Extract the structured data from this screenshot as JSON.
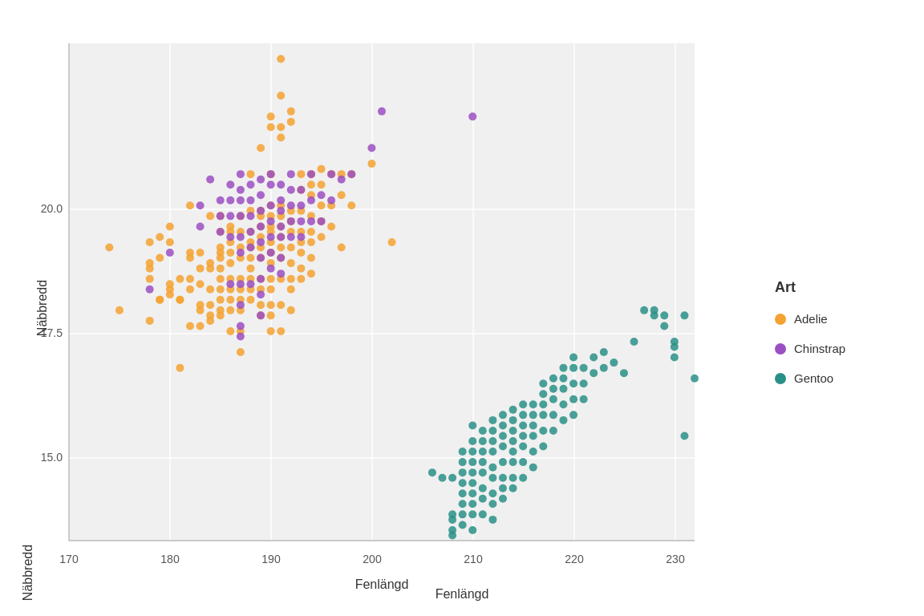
{
  "chart": {
    "title": "",
    "x_label": "Fenlängd",
    "y_label": "Näbbredd",
    "x_min": 170,
    "x_max": 232,
    "y_min": 13.0,
    "y_max": 22.5,
    "x_ticks": [
      170,
      180,
      190,
      200,
      210,
      220,
      230
    ],
    "y_ticks": [
      15.0,
      17.5,
      20.0
    ],
    "background_color": "#f5f5f5",
    "grid_color": "#ffffff"
  },
  "legend": {
    "title": "Art",
    "items": [
      {
        "label": "Adelie",
        "color": "#F4A231",
        "dot_color": "#F4A231"
      },
      {
        "label": "Chinstrap",
        "color": "#9B4FC2",
        "dot_color": "#9B4FC2"
      },
      {
        "label": "Gentoo",
        "color": "#2A9087",
        "dot_color": "#2A9087"
      }
    ]
  },
  "data": {
    "adelie": [
      [
        174,
        18.6
      ],
      [
        175,
        17.4
      ],
      [
        178,
        18.7
      ],
      [
        178,
        18.3
      ],
      [
        178,
        18.0
      ],
      [
        178,
        18.2
      ],
      [
        178,
        17.2
      ],
      [
        179,
        17.6
      ],
      [
        179,
        18.8
      ],
      [
        179,
        17.6
      ],
      [
        179,
        18.4
      ],
      [
        180,
        19.0
      ],
      [
        180,
        18.7
      ],
      [
        180,
        17.9
      ],
      [
        180,
        17.7
      ],
      [
        180,
        17.8
      ],
      [
        181,
        18.0
      ],
      [
        181,
        17.6
      ],
      [
        181,
        17.6
      ],
      [
        181,
        16.3
      ],
      [
        182,
        19.4
      ],
      [
        182,
        18.5
      ],
      [
        182,
        18.4
      ],
      [
        182,
        18.0
      ],
      [
        182,
        17.8
      ],
      [
        182,
        17.1
      ],
      [
        183,
        18.5
      ],
      [
        183,
        18.2
      ],
      [
        183,
        17.9
      ],
      [
        183,
        17.5
      ],
      [
        183,
        17.4
      ],
      [
        183,
        17.1
      ],
      [
        184,
        19.2
      ],
      [
        184,
        18.3
      ],
      [
        184,
        18.2
      ],
      [
        184,
        17.8
      ],
      [
        184,
        17.5
      ],
      [
        184,
        17.3
      ],
      [
        184,
        17.2
      ],
      [
        185,
        19.2
      ],
      [
        185,
        18.9
      ],
      [
        185,
        18.6
      ],
      [
        185,
        18.5
      ],
      [
        185,
        18.4
      ],
      [
        185,
        18.2
      ],
      [
        185,
        18.0
      ],
      [
        185,
        17.8
      ],
      [
        185,
        17.6
      ],
      [
        185,
        17.4
      ],
      [
        185,
        17.3
      ],
      [
        186,
        19.0
      ],
      [
        186,
        18.9
      ],
      [
        186,
        18.7
      ],
      [
        186,
        18.5
      ],
      [
        186,
        18.3
      ],
      [
        186,
        18.0
      ],
      [
        186,
        17.8
      ],
      [
        186,
        17.6
      ],
      [
        186,
        17.4
      ],
      [
        186,
        17.0
      ],
      [
        187,
        19.2
      ],
      [
        187,
        18.9
      ],
      [
        187,
        18.6
      ],
      [
        187,
        18.4
      ],
      [
        187,
        18.0
      ],
      [
        187,
        17.8
      ],
      [
        187,
        17.6
      ],
      [
        187,
        17.4
      ],
      [
        187,
        17.0
      ],
      [
        187,
        16.6
      ],
      [
        188,
        20.0
      ],
      [
        188,
        19.3
      ],
      [
        188,
        18.9
      ],
      [
        188,
        18.7
      ],
      [
        188,
        18.6
      ],
      [
        188,
        18.4
      ],
      [
        188,
        18.2
      ],
      [
        188,
        18.0
      ],
      [
        188,
        17.8
      ],
      [
        188,
        17.6
      ],
      [
        189,
        20.5
      ],
      [
        189,
        19.3
      ],
      [
        189,
        19.2
      ],
      [
        189,
        19.0
      ],
      [
        189,
        18.8
      ],
      [
        189,
        18.6
      ],
      [
        189,
        18.4
      ],
      [
        189,
        18.0
      ],
      [
        189,
        17.8
      ],
      [
        189,
        17.5
      ],
      [
        189,
        17.3
      ],
      [
        190,
        21.1
      ],
      [
        190,
        20.9
      ],
      [
        190,
        20.0
      ],
      [
        190,
        19.4
      ],
      [
        190,
        19.2
      ],
      [
        190,
        19.0
      ],
      [
        190,
        18.9
      ],
      [
        190,
        18.7
      ],
      [
        190,
        18.5
      ],
      [
        190,
        18.3
      ],
      [
        190,
        18.0
      ],
      [
        190,
        17.8
      ],
      [
        190,
        17.5
      ],
      [
        190,
        17.3
      ],
      [
        190,
        17.0
      ],
      [
        191,
        22.2
      ],
      [
        191,
        21.5
      ],
      [
        191,
        20.9
      ],
      [
        191,
        20.7
      ],
      [
        191,
        19.4
      ],
      [
        191,
        19.2
      ],
      [
        191,
        19.0
      ],
      [
        191,
        18.8
      ],
      [
        191,
        18.6
      ],
      [
        191,
        18.4
      ],
      [
        191,
        18.0
      ],
      [
        191,
        17.5
      ],
      [
        191,
        17.0
      ],
      [
        192,
        21.2
      ],
      [
        192,
        21.0
      ],
      [
        192,
        19.3
      ],
      [
        192,
        19.1
      ],
      [
        192,
        18.9
      ],
      [
        192,
        18.6
      ],
      [
        192,
        18.3
      ],
      [
        192,
        18.0
      ],
      [
        192,
        17.8
      ],
      [
        192,
        17.4
      ],
      [
        193,
        20.0
      ],
      [
        193,
        19.7
      ],
      [
        193,
        19.3
      ],
      [
        193,
        18.9
      ],
      [
        193,
        18.7
      ],
      [
        193,
        18.5
      ],
      [
        193,
        18.2
      ],
      [
        193,
        18.0
      ],
      [
        194,
        20.0
      ],
      [
        194,
        19.8
      ],
      [
        194,
        19.6
      ],
      [
        194,
        19.2
      ],
      [
        194,
        18.9
      ],
      [
        194,
        18.7
      ],
      [
        194,
        18.4
      ],
      [
        194,
        18.1
      ],
      [
        195,
        20.1
      ],
      [
        195,
        19.8
      ],
      [
        195,
        19.4
      ],
      [
        195,
        19.1
      ],
      [
        195,
        18.8
      ],
      [
        196,
        20.0
      ],
      [
        196,
        19.4
      ],
      [
        196,
        19.0
      ],
      [
        197,
        20.0
      ],
      [
        197,
        19.6
      ],
      [
        197,
        18.6
      ],
      [
        198,
        20.0
      ],
      [
        198,
        19.4
      ],
      [
        200,
        20.2
      ],
      [
        202,
        18.7
      ]
    ],
    "chinstrap": [
      [
        178,
        17.8
      ],
      [
        180,
        18.5
      ],
      [
        183,
        19.4
      ],
      [
        183,
        19.0
      ],
      [
        184,
        19.9
      ],
      [
        185,
        19.5
      ],
      [
        185,
        19.2
      ],
      [
        185,
        18.9
      ],
      [
        186,
        19.8
      ],
      [
        186,
        19.5
      ],
      [
        186,
        19.2
      ],
      [
        186,
        18.8
      ],
      [
        186,
        17.9
      ],
      [
        187,
        20.0
      ],
      [
        187,
        19.7
      ],
      [
        187,
        19.5
      ],
      [
        187,
        19.2
      ],
      [
        187,
        18.8
      ],
      [
        187,
        18.5
      ],
      [
        187,
        17.9
      ],
      [
        187,
        17.5
      ],
      [
        187,
        17.1
      ],
      [
        187,
        16.9
      ],
      [
        188,
        19.8
      ],
      [
        188,
        19.5
      ],
      [
        188,
        19.2
      ],
      [
        188,
        18.9
      ],
      [
        188,
        18.6
      ],
      [
        188,
        17.9
      ],
      [
        189,
        19.9
      ],
      [
        189,
        19.6
      ],
      [
        189,
        19.3
      ],
      [
        189,
        19.0
      ],
      [
        189,
        18.7
      ],
      [
        189,
        18.4
      ],
      [
        189,
        18.0
      ],
      [
        189,
        17.7
      ],
      [
        189,
        17.3
      ],
      [
        190,
        20.0
      ],
      [
        190,
        19.8
      ],
      [
        190,
        19.4
      ],
      [
        190,
        19.1
      ],
      [
        190,
        18.8
      ],
      [
        190,
        18.5
      ],
      [
        190,
        18.2
      ],
      [
        191,
        19.8
      ],
      [
        191,
        19.5
      ],
      [
        191,
        19.3
      ],
      [
        191,
        19.0
      ],
      [
        191,
        18.8
      ],
      [
        191,
        18.4
      ],
      [
        191,
        18.1
      ],
      [
        192,
        20.0
      ],
      [
        192,
        19.7
      ],
      [
        192,
        19.4
      ],
      [
        192,
        19.1
      ],
      [
        192,
        18.8
      ],
      [
        193,
        19.7
      ],
      [
        193,
        19.4
      ],
      [
        193,
        19.1
      ],
      [
        193,
        18.8
      ],
      [
        194,
        20.0
      ],
      [
        194,
        19.5
      ],
      [
        194,
        19.1
      ],
      [
        195,
        19.6
      ],
      [
        195,
        19.1
      ],
      [
        196,
        20.0
      ],
      [
        196,
        19.5
      ],
      [
        197,
        19.9
      ],
      [
        198,
        20.0
      ],
      [
        200,
        20.5
      ],
      [
        201,
        21.2
      ],
      [
        210,
        21.1
      ]
    ],
    "gentoo": [
      [
        206,
        14.3
      ],
      [
        207,
        14.2
      ],
      [
        208,
        14.2
      ],
      [
        208,
        13.5
      ],
      [
        208,
        13.4
      ],
      [
        208,
        13.2
      ],
      [
        208,
        13.1
      ],
      [
        209,
        14.7
      ],
      [
        209,
        14.5
      ],
      [
        209,
        14.3
      ],
      [
        209,
        14.1
      ],
      [
        209,
        13.9
      ],
      [
        209,
        13.7
      ],
      [
        209,
        13.5
      ],
      [
        209,
        13.3
      ],
      [
        210,
        15.2
      ],
      [
        210,
        14.9
      ],
      [
        210,
        14.7
      ],
      [
        210,
        14.5
      ],
      [
        210,
        14.3
      ],
      [
        210,
        14.1
      ],
      [
        210,
        13.9
      ],
      [
        210,
        13.7
      ],
      [
        210,
        13.5
      ],
      [
        210,
        13.2
      ],
      [
        211,
        15.1
      ],
      [
        211,
        14.9
      ],
      [
        211,
        14.7
      ],
      [
        211,
        14.5
      ],
      [
        211,
        14.3
      ],
      [
        211,
        14.0
      ],
      [
        211,
        13.8
      ],
      [
        211,
        13.5
      ],
      [
        212,
        15.3
      ],
      [
        212,
        15.1
      ],
      [
        212,
        14.9
      ],
      [
        212,
        14.7
      ],
      [
        212,
        14.4
      ],
      [
        212,
        14.2
      ],
      [
        212,
        13.9
      ],
      [
        212,
        13.7
      ],
      [
        212,
        13.4
      ],
      [
        213,
        15.4
      ],
      [
        213,
        15.2
      ],
      [
        213,
        15.0
      ],
      [
        213,
        14.8
      ],
      [
        213,
        14.5
      ],
      [
        213,
        14.2
      ],
      [
        213,
        14.0
      ],
      [
        213,
        13.8
      ],
      [
        214,
        15.5
      ],
      [
        214,
        15.3
      ],
      [
        214,
        15.1
      ],
      [
        214,
        14.9
      ],
      [
        214,
        14.7
      ],
      [
        214,
        14.5
      ],
      [
        214,
        14.2
      ],
      [
        214,
        14.0
      ],
      [
        215,
        15.6
      ],
      [
        215,
        15.4
      ],
      [
        215,
        15.2
      ],
      [
        215,
        15.0
      ],
      [
        215,
        14.8
      ],
      [
        215,
        14.5
      ],
      [
        215,
        14.2
      ],
      [
        216,
        15.6
      ],
      [
        216,
        15.4
      ],
      [
        216,
        15.2
      ],
      [
        216,
        15.0
      ],
      [
        216,
        14.7
      ],
      [
        216,
        14.4
      ],
      [
        217,
        16.0
      ],
      [
        217,
        15.8
      ],
      [
        217,
        15.6
      ],
      [
        217,
        15.4
      ],
      [
        217,
        15.1
      ],
      [
        217,
        14.8
      ],
      [
        218,
        16.1
      ],
      [
        218,
        15.9
      ],
      [
        218,
        15.7
      ],
      [
        218,
        15.4
      ],
      [
        218,
        15.1
      ],
      [
        219,
        16.3
      ],
      [
        219,
        16.1
      ],
      [
        219,
        15.9
      ],
      [
        219,
        15.6
      ],
      [
        219,
        15.3
      ],
      [
        220,
        16.5
      ],
      [
        220,
        16.3
      ],
      [
        220,
        16.0
      ],
      [
        220,
        15.7
      ],
      [
        220,
        15.4
      ],
      [
        221,
        16.3
      ],
      [
        221,
        16.0
      ],
      [
        221,
        15.7
      ],
      [
        222,
        16.5
      ],
      [
        222,
        16.2
      ],
      [
        223,
        16.6
      ],
      [
        223,
        16.3
      ],
      [
        224,
        16.4
      ],
      [
        225,
        16.2
      ],
      [
        226,
        16.8
      ],
      [
        227,
        17.4
      ],
      [
        228,
        17.4
      ],
      [
        228,
        17.3
      ],
      [
        229,
        17.3
      ],
      [
        229,
        17.1
      ],
      [
        230,
        16.8
      ],
      [
        230,
        16.7
      ],
      [
        230,
        16.5
      ],
      [
        231,
        17.3
      ],
      [
        231,
        15.0
      ],
      [
        232,
        16.1
      ]
    ]
  }
}
